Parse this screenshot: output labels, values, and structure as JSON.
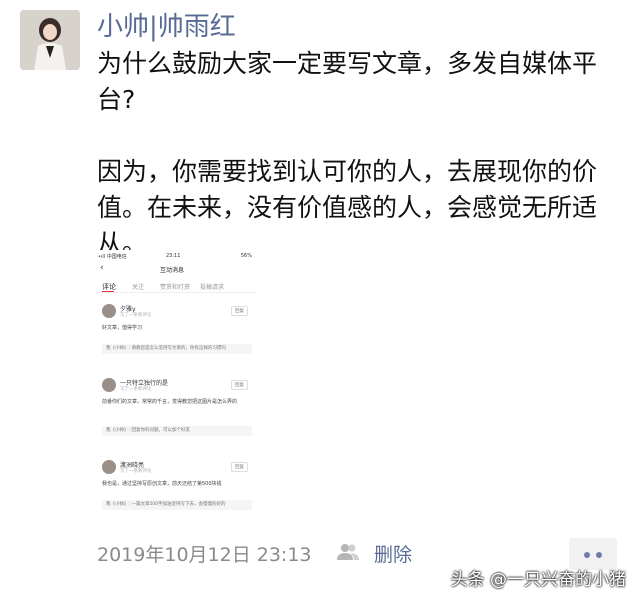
{
  "post": {
    "author": "小帅|帅雨红",
    "paragraph1": "为什么鼓励大家一定要写文章，多发自媒体平台?",
    "paragraph2": "因为，你需要找到认可你的人，去展现你的价值。在未来，没有价值感的人，会感觉无所适从。",
    "timestamp": "2019年10月12日 23:13",
    "delete_label": "删除"
  },
  "screenshot": {
    "status_left": "•ıll 中国电信",
    "status_time": "23:11",
    "status_right": "56%",
    "title": "互动消息",
    "tabs": [
      "评论",
      "关注",
      "赞赏和打赏",
      "投稿请求"
    ],
    "comments": [
      {
        "name": "夕雅y",
        "sub": "写了一条新评论",
        "reply": "回复",
        "text": "好文章，值得学习",
        "quote": "我《小帅》: 请教您是怎么坚持写文章的，你有这样的习惯吗"
      },
      {
        "name": "一只特立独行的是",
        "sub": "写了一条新评论",
        "reply": "回复",
        "text": "前番你们的文章，常常的千言，觉得教您把这图片是怎么弄的",
        "quote": "我《小帅》: 回复你的问题，可以加个好友"
      },
      {
        "name": "渡洲晓亮",
        "sub": "写了一条新评论",
        "reply": "回复",
        "text": "我也是，通过坚持写原创文章，前天还结了第500块钱",
        "quote": "我《小帅》: 一篇文章500字加油坚持写下去，会慢慢的好的"
      }
    ]
  },
  "watermark": "头条 @一只兴奋的小猪",
  "colors": {
    "link_blue": "#576b95",
    "meta_gray": "#8a8a8a"
  }
}
